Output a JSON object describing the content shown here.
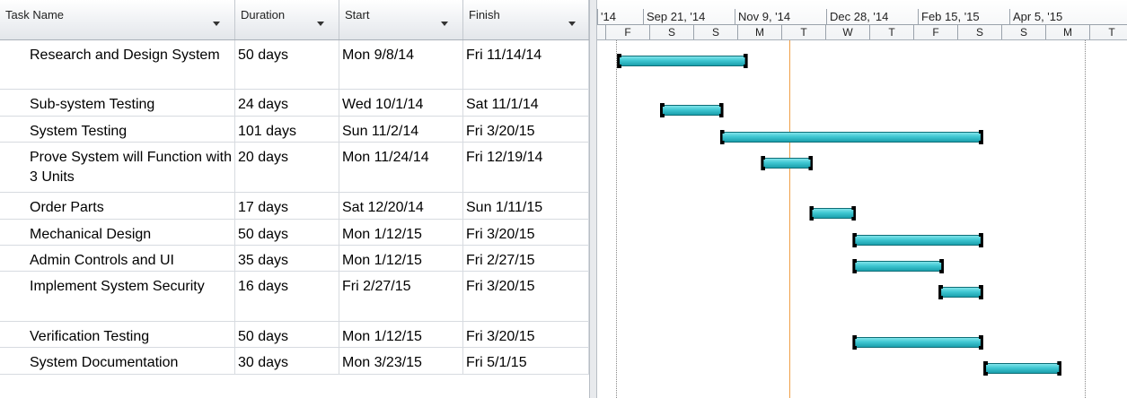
{
  "columns": {
    "task_name": "Task Name",
    "duration": "Duration",
    "start": "Start",
    "finish": "Finish"
  },
  "timescale": {
    "major": [
      "'14",
      "Sep 21, '14",
      "Nov 9, '14",
      "Dec 28, '14",
      "Feb 15, '15",
      "Apr 5, '15"
    ],
    "minor": [
      "F",
      "S",
      "S",
      "M",
      "T",
      "W",
      "T",
      "F",
      "S",
      "S",
      "M",
      "T"
    ]
  },
  "tasks": [
    {
      "name": "Research and Design System",
      "duration": "50 days",
      "start": "Mon 9/8/14",
      "finish": "Fri 11/14/14"
    },
    {
      "name": " Sub-system Testing",
      "duration": "24 days",
      "start": "Wed 10/1/14",
      "finish": "Sat 11/1/14"
    },
    {
      "name": "System Testing",
      "duration": "101 days",
      "start": "Sun 11/2/14",
      "finish": "Fri 3/20/15"
    },
    {
      "name": "Prove System will Function with 3 Units",
      "duration": "20 days",
      "start": "Mon 11/24/14",
      "finish": "Fri 12/19/14"
    },
    {
      "name": "Order Parts",
      "duration": "17 days",
      "start": "Sat 12/20/14",
      "finish": "Sun 1/11/15"
    },
    {
      "name": "Mechanical Design",
      "duration": "50 days",
      "start": "Mon 1/12/15",
      "finish": "Fri 3/20/15"
    },
    {
      "name": "Admin Controls and UI",
      "duration": "35 days",
      "start": "Mon 1/12/15",
      "finish": "Fri 2/27/15"
    },
    {
      "name": "Implement System Security",
      "duration": "16 days",
      "start": "Fri 2/27/15",
      "finish": "Fri 3/20/15"
    },
    {
      "name": "Verification Testing",
      "duration": "50 days",
      "start": "Mon 1/12/15",
      "finish": "Fri 3/20/15"
    },
    {
      "name": "System Documentation",
      "duration": "30 days",
      "start": "Mon 3/23/15",
      "finish": "Fri 5/1/15"
    }
  ],
  "colors": {
    "bar": "#3fc7d2",
    "today_line": "#f0a048",
    "grid_line": "#d7dbe0"
  },
  "status_date": "Mon 12/8/14"
}
